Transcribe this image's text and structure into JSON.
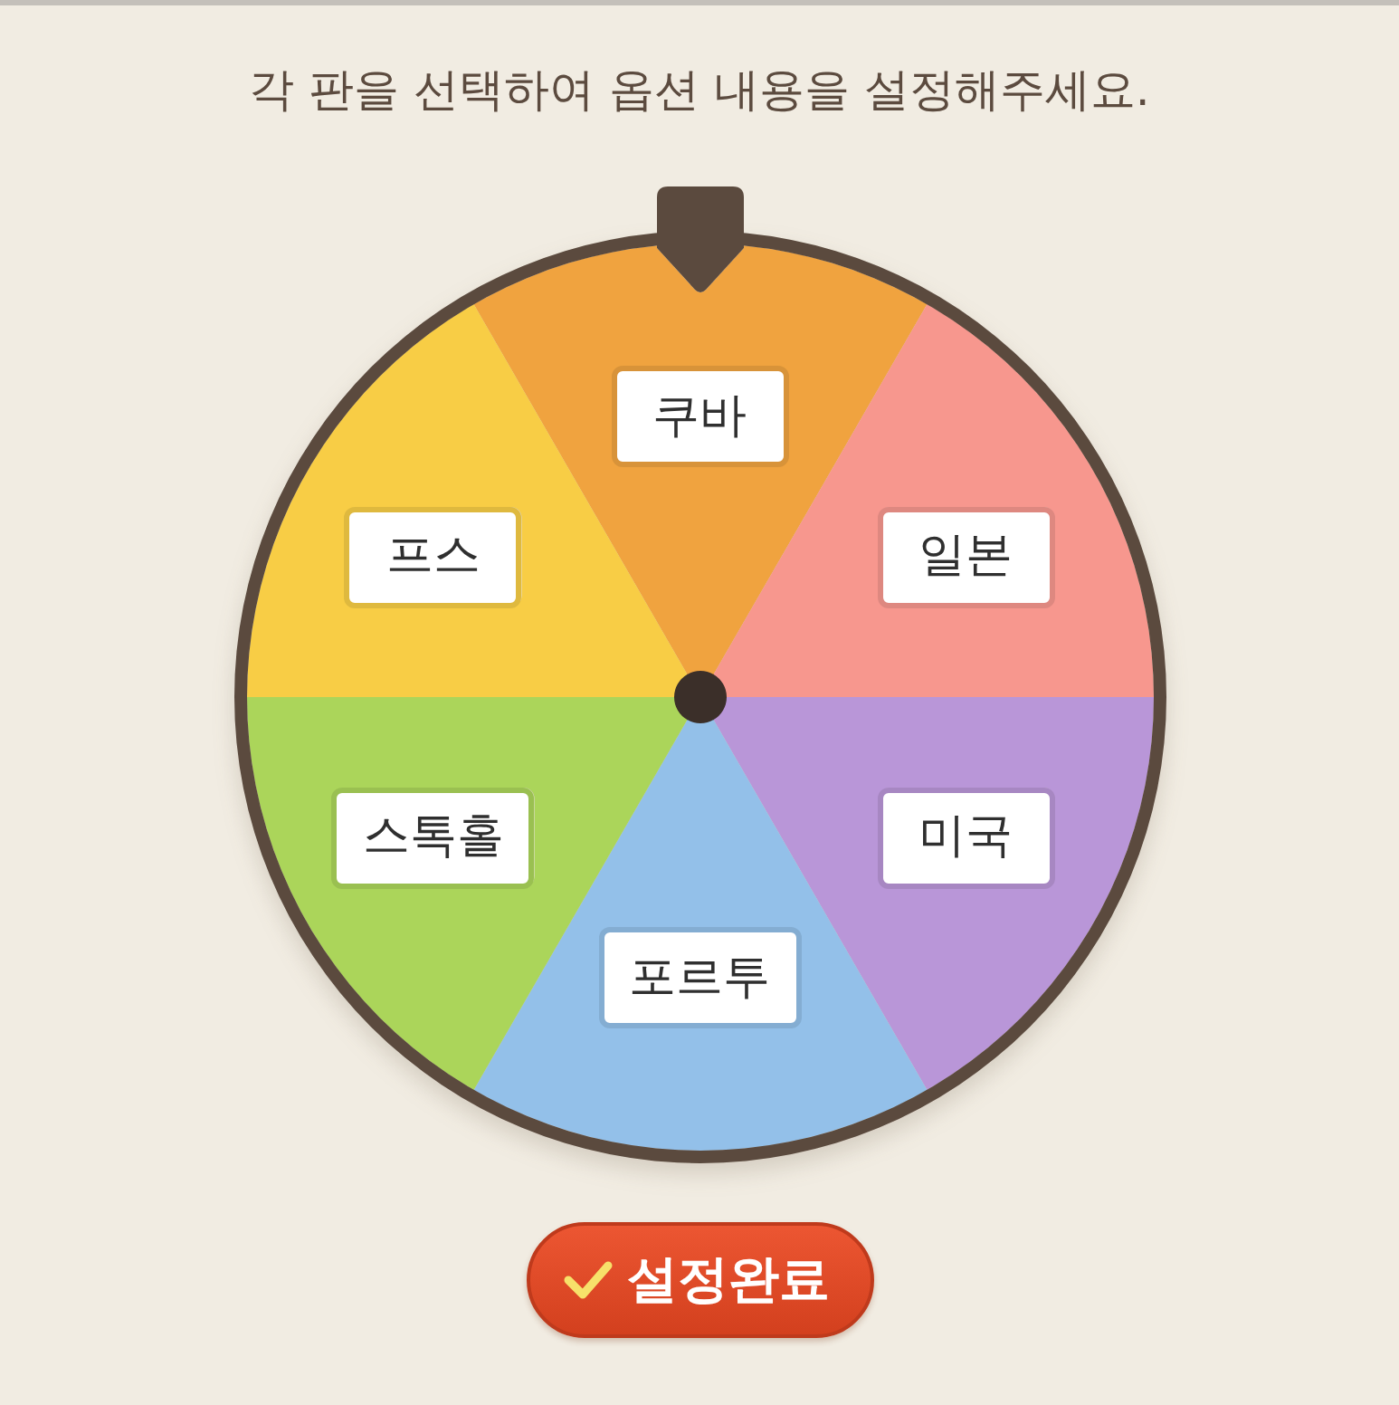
{
  "instruction": "각 판을 선택하여 옵션 내용을 설정해주세요.",
  "wheel": {
    "segments": [
      {
        "label": "쿠바",
        "color": "#f0a33f"
      },
      {
        "label": "일본",
        "color": "#f7978e"
      },
      {
        "label": "미국",
        "color": "#b996d8"
      },
      {
        "label": "포르투",
        "color": "#93c0e9"
      },
      {
        "label": "스톡홀",
        "color": "#abd55a"
      },
      {
        "label": "프스",
        "color": "#f8cd45"
      }
    ]
  },
  "button": {
    "label": "설정완료"
  }
}
